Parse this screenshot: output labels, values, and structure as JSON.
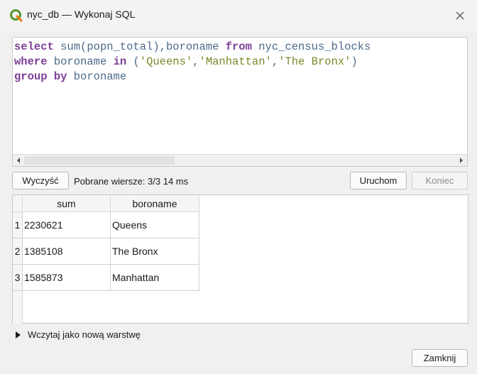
{
  "window": {
    "title": "nyc_db — Wykonaj SQL"
  },
  "editor": {
    "lines": [
      [
        {
          "t": "select",
          "c": "kw"
        },
        {
          "t": " ",
          "c": "id"
        },
        {
          "t": "sum",
          "c": "id"
        },
        {
          "t": "(",
          "c": "punc"
        },
        {
          "t": "popn_total",
          "c": "id"
        },
        {
          "t": "),",
          "c": "punc"
        },
        {
          "t": "boroname",
          "c": "id"
        },
        {
          "t": " ",
          "c": "id"
        },
        {
          "t": "from",
          "c": "kw"
        },
        {
          "t": " ",
          "c": "id"
        },
        {
          "t": "nyc_census_blocks",
          "c": "id"
        }
      ],
      [
        {
          "t": "where",
          "c": "kw"
        },
        {
          "t": " ",
          "c": "id"
        },
        {
          "t": "boroname",
          "c": "id"
        },
        {
          "t": " ",
          "c": "id"
        },
        {
          "t": "in",
          "c": "kw"
        },
        {
          "t": " (",
          "c": "punc"
        },
        {
          "t": "'Queens'",
          "c": "str"
        },
        {
          "t": ",",
          "c": "punc"
        },
        {
          "t": "'Manhattan'",
          "c": "str"
        },
        {
          "t": ",",
          "c": "punc"
        },
        {
          "t": "'The Bronx'",
          "c": "str"
        },
        {
          "t": ")",
          "c": "punc"
        }
      ],
      [
        {
          "t": "group",
          "c": "kw"
        },
        {
          "t": " ",
          "c": "id"
        },
        {
          "t": "by",
          "c": "kw"
        },
        {
          "t": " ",
          "c": "id"
        },
        {
          "t": "boroname",
          "c": "id"
        }
      ]
    ],
    "scroll_thumb_fraction": 0.34
  },
  "toolbar": {
    "clear_label": "Wyczyść",
    "status_text": "Pobrane wiersze: 3/3  14 ms",
    "run_label": "Uruchom",
    "stop_label": "Koniec"
  },
  "results": {
    "columns": [
      "sum",
      "boroname"
    ],
    "rows": [
      {
        "num": "1",
        "sum": "2230621",
        "boroname": "Queens"
      },
      {
        "num": "2",
        "sum": "1385108",
        "boroname": "The Bronx"
      },
      {
        "num": "3",
        "sum": "1585873",
        "boroname": "Manhattan"
      }
    ]
  },
  "load_layer_label": "Wczytaj jako nową warstwę",
  "close_label": "Zamknij",
  "colors": {
    "keyword": "#7c3e98",
    "identifier": "#4d6a8a",
    "string": "#7a8a2c",
    "qgis_green": "#589632",
    "qgis_yellow": "#ee7913"
  },
  "icons": {
    "app": "qgis-logo-icon",
    "close": "close-icon",
    "scroll_left": "arrow-left-icon",
    "scroll_right": "arrow-right-icon",
    "expand": "triangle-right-icon"
  }
}
